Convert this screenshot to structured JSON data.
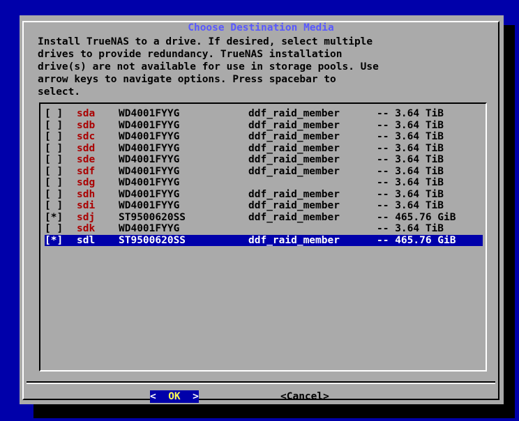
{
  "dialog": {
    "title": "Choose Destination Media",
    "description": "Install TrueNAS to a drive. If desired, select multiple\ndrives to provide redundancy. TrueNAS installation\ndrive(s) are not available for use in storage pools. Use\narrow keys to navigate options. Press spacebar to\nselect."
  },
  "drives": [
    {
      "check": "[ ]",
      "device": "sda",
      "model": "WD4001FYYG",
      "fs": "ddf_raid_member",
      "size": "-- 3.64 TiB"
    },
    {
      "check": "[ ]",
      "device": "sdb",
      "model": "WD4001FYYG",
      "fs": "ddf_raid_member",
      "size": "-- 3.64 TiB"
    },
    {
      "check": "[ ]",
      "device": "sdc",
      "model": "WD4001FYYG",
      "fs": "ddf_raid_member",
      "size": "-- 3.64 TiB"
    },
    {
      "check": "[ ]",
      "device": "sdd",
      "model": "WD4001FYYG",
      "fs": "ddf_raid_member",
      "size": "-- 3.64 TiB"
    },
    {
      "check": "[ ]",
      "device": "sde",
      "model": "WD4001FYYG",
      "fs": "ddf_raid_member",
      "size": "-- 3.64 TiB"
    },
    {
      "check": "[ ]",
      "device": "sdf",
      "model": "WD4001FYYG",
      "fs": "ddf_raid_member",
      "size": "-- 3.64 TiB"
    },
    {
      "check": "[ ]",
      "device": "sdg",
      "model": "WD4001FYYG",
      "fs": "",
      "size": "-- 3.64 TiB"
    },
    {
      "check": "[ ]",
      "device": "sdh",
      "model": "WD4001FYYG",
      "fs": "ddf_raid_member",
      "size": "-- 3.64 TiB"
    },
    {
      "check": "[ ]",
      "device": "sdi",
      "model": "WD4001FYYG",
      "fs": "ddf_raid_member",
      "size": "-- 3.64 TiB"
    },
    {
      "check": "[*]",
      "device": "sdj",
      "model": "ST9500620SS",
      "fs": "ddf_raid_member",
      "size": "-- 465.76 GiB"
    },
    {
      "check": "[ ]",
      "device": "sdk",
      "model": "WD4001FYYG",
      "fs": "",
      "size": "-- 3.64 TiB"
    },
    {
      "check": "[*]",
      "device": "sdl",
      "model": "ST9500620SS",
      "fs": "ddf_raid_member",
      "size": "-- 465.76 GiB",
      "selected": true
    }
  ],
  "buttons": {
    "ok_left": "<",
    "ok_label": "OK",
    "ok_right": ">",
    "cancel_label": "<Cancel>"
  },
  "colors": {
    "background": "#0000aa",
    "dialog": "#aaaaaa",
    "title": "#5858ff",
    "device": "#aa0000",
    "highlight": "#0000aa"
  }
}
